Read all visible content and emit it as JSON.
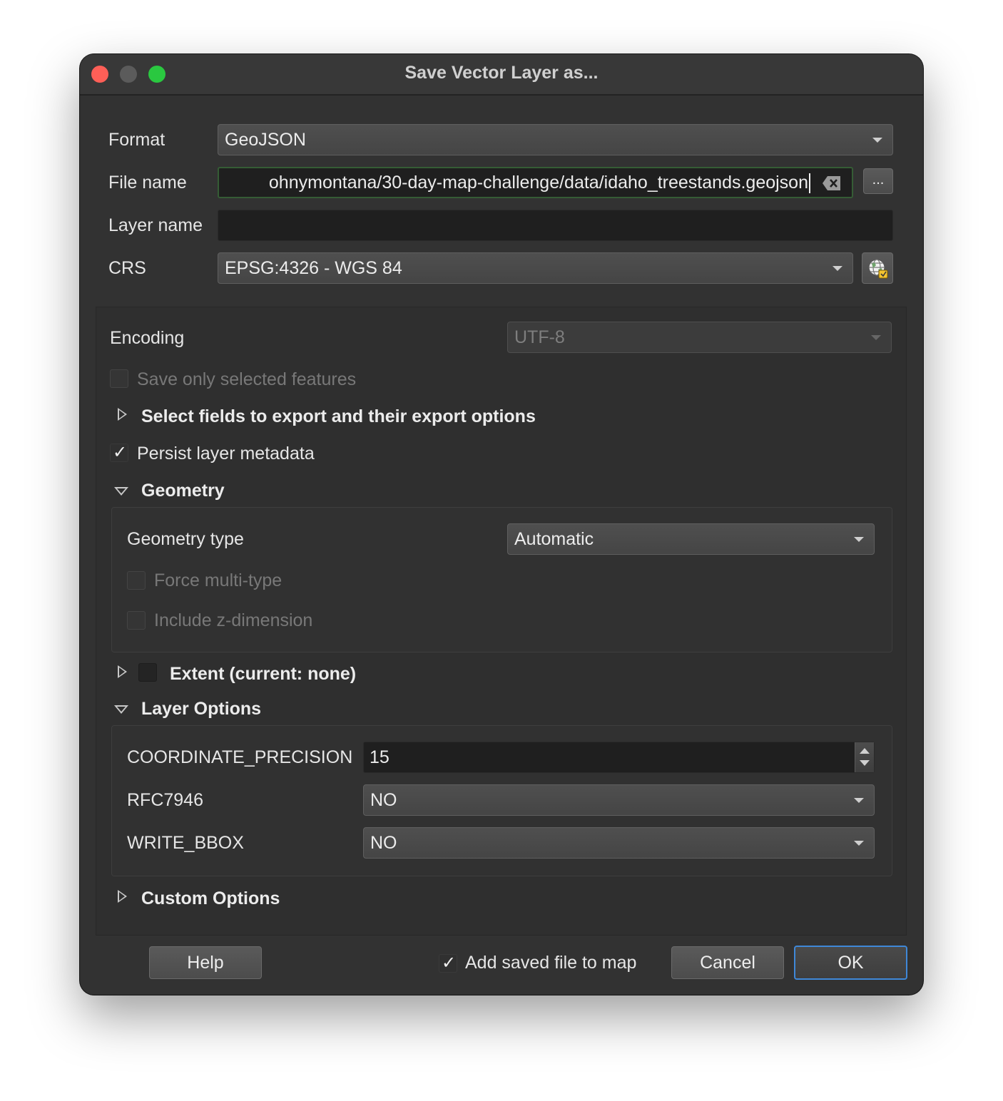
{
  "window": {
    "title": "Save Vector Layer as..."
  },
  "form": {
    "format_label": "Format",
    "format_value": "GeoJSON",
    "filename_label": "File name",
    "filename_value": "ohnymontana/30-day-map-challenge/data/idaho_treestands.geojson",
    "filename_browse_label": "...",
    "layername_label": "Layer name",
    "layername_value": "",
    "crs_label": "CRS",
    "crs_value": "EPSG:4326 - WGS 84"
  },
  "options": {
    "encoding_label": "Encoding",
    "encoding_value": "UTF-8",
    "save_selected_label": "Save only selected features",
    "select_fields_label": "Select fields to export and their export options",
    "persist_metadata_label": "Persist layer metadata",
    "persist_metadata_checked": true
  },
  "geometry": {
    "header": "Geometry",
    "type_label": "Geometry type",
    "type_value": "Automatic",
    "force_multi_label": "Force multi-type",
    "include_z_label": "Include z-dimension"
  },
  "extent": {
    "header": "Extent (current: none)"
  },
  "layer_options": {
    "header": "Layer Options",
    "coordinate_precision_label": "COORDINATE_PRECISION",
    "coordinate_precision_value": "15",
    "rfc7946_label": "RFC7946",
    "rfc7946_value": "NO",
    "write_bbox_label": "WRITE_BBOX",
    "write_bbox_value": "NO"
  },
  "custom_options": {
    "header": "Custom Options"
  },
  "footer": {
    "help_label": "Help",
    "add_to_map_label": "Add saved file to map",
    "add_to_map_checked": true,
    "cancel_label": "Cancel",
    "ok_label": "OK"
  },
  "icons": {
    "clear": "clear-text-icon",
    "crs_select": "globe-crs-icon",
    "expand": "triangle-right-icon",
    "collapse": "triangle-down-icon",
    "checkmark": "checkmark-icon"
  },
  "colors": {
    "window_bg": "#323232",
    "close": "#fe5f57",
    "minimize": "#5b5b5b",
    "maximize": "#2ac840",
    "ok_border": "#3f88d8"
  }
}
